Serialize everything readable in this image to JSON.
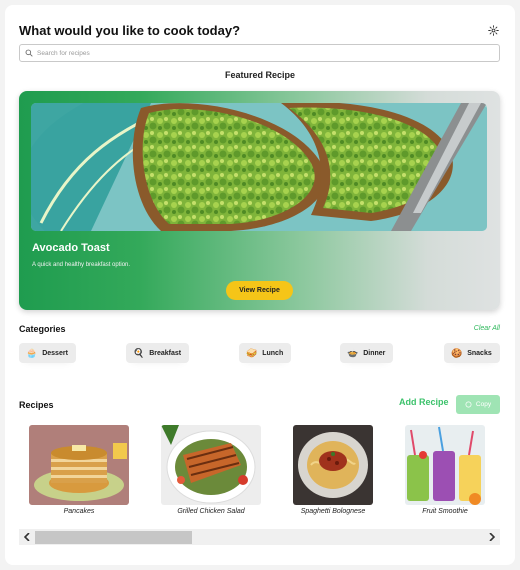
{
  "header": {
    "title": "What would you like to cook today?",
    "settings_icon": "gear-icon"
  },
  "search": {
    "placeholder": "Search for recipes",
    "value": ""
  },
  "featured": {
    "section_title": "Featured Recipe",
    "name": "Avocado Toast",
    "description": "A quick and healthy breakfast option.",
    "button_label": "View Recipe"
  },
  "categories": {
    "title": "Categories",
    "clear_label": "Clear All",
    "items": [
      {
        "label": "Dessert",
        "icon": "cupcake-icon"
      },
      {
        "label": "Breakfast",
        "icon": "breakfast-icon"
      },
      {
        "label": "Lunch",
        "icon": "lunch-icon"
      },
      {
        "label": "Dinner",
        "icon": "dinner-icon"
      },
      {
        "label": "Snacks",
        "icon": "snacks-icon"
      }
    ]
  },
  "recipes": {
    "title": "Recipes",
    "add_label": "Add Recipe",
    "copy_label": "Copy",
    "items": [
      {
        "name": "Pancakes"
      },
      {
        "name": "Grilled Chicken Salad"
      },
      {
        "name": "Spaghetti Bolognese"
      },
      {
        "name": "Fruit Smoothie"
      }
    ]
  },
  "colors": {
    "accent_green": "#2db85b",
    "button_yellow": "#f5c518"
  }
}
